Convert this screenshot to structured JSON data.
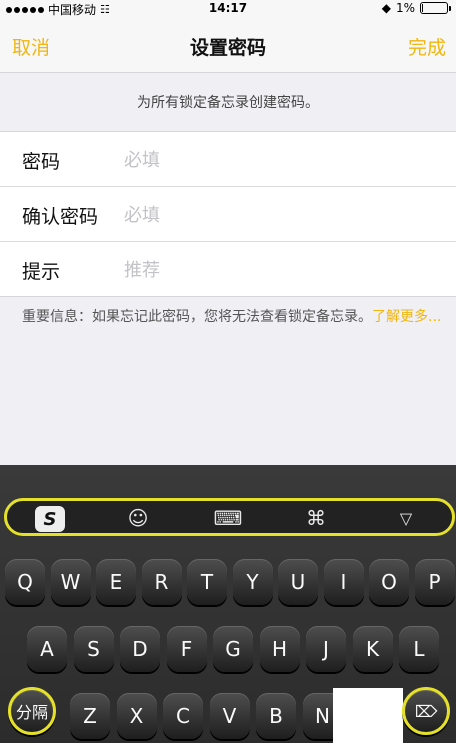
{
  "status_bar": {
    "carrier": "中国移动",
    "time": "14:17",
    "battery_percent": "1%",
    "battery_level": 0.01,
    "signal_icon": "signal-dots-icon",
    "wifi_icon": "wifi-icon",
    "lock_icon": "rotation-lock-icon"
  },
  "nav": {
    "cancel_label": "取消",
    "title": "设置密码",
    "done_label": "完成"
  },
  "header_note": "为所有锁定备忘录创建密码。",
  "form": {
    "rows": [
      {
        "label": "密码",
        "placeholder": "必填",
        "value": ""
      },
      {
        "label": "确认密码",
        "placeholder": "必填",
        "value": ""
      },
      {
        "label": "提示",
        "placeholder": "推荐",
        "value": ""
      }
    ]
  },
  "important": {
    "text": "重要信息：如果忘记此密码，您将无法查看锁定备忘录。",
    "link": "了解更多..."
  },
  "keyboard": {
    "toolbar_icons": [
      "sogou-logo-icon",
      "emoji-icon",
      "keyboard-icon",
      "clover-icon",
      "collapse-triangle-icon"
    ],
    "sogou_letter": "S",
    "row1": [
      "Q",
      "W",
      "E",
      "R",
      "T",
      "Y",
      "U",
      "I",
      "O",
      "P"
    ],
    "row2": [
      "A",
      "S",
      "D",
      "F",
      "G",
      "H",
      "J",
      "K",
      "L"
    ],
    "row3": [
      "Z",
      "X",
      "C",
      "V",
      "B",
      "N"
    ],
    "separator_label": "分隔",
    "delete_icon": "delete-icon",
    "accent_color": "#e5e02a",
    "link_color": "#f1b60f"
  }
}
